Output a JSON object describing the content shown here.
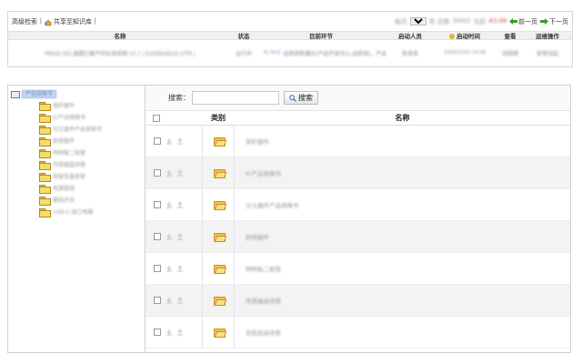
{
  "toolbar": {
    "advanced_search": "高级检索",
    "separator": "|",
    "share_label": "共享至知识库",
    "pager": {
      "page_text_1": "每页",
      "page_text_2": "条 总数",
      "total_count": "30402",
      "page_text_3": "当前",
      "current_page": "4/1-04",
      "prev_label": "前一页",
      "next_label": "下一页"
    }
  },
  "process_grid": {
    "columns": [
      "名称",
      "状态",
      "目前环节",
      "启动人员",
      "启动时间",
      "查看",
      "运维操作"
    ],
    "rows": [
      {
        "name": "PROD-002 晶圆已量产的标准规格 V1.7 ( D1D5624D15-1/TR )",
        "status": "运行中",
        "step": "IC N-D",
        "step_detail": "品质部陈康乐(产品开发中心-品质部)、产品",
        "starter": "陈某某",
        "start_time": "2023/11/01 15:36",
        "view": "流程图",
        "op": "审单挂起"
      }
    ]
  },
  "tree": {
    "root": "产品规格书",
    "items": [
      "保护器件",
      "IC产品规格书",
      "分立器件产品规格书",
      "射频器件",
      "特种板二极管",
      "传感器晶体管",
      "双极型晶体管",
      "电源管理",
      "模拟开关",
      "USB-C 接口电路"
    ]
  },
  "search": {
    "label": "搜索：",
    "input_value": "",
    "button_label": "搜索"
  },
  "list": {
    "col_type": "类别",
    "col_name": "名称",
    "rows": [
      {
        "name": "保护器件"
      },
      {
        "name": "IC产品规格书"
      },
      {
        "name": "分立器件产品规格书"
      },
      {
        "name": "射频器件"
      },
      {
        "name": "特种板二极管"
      },
      {
        "name": "传感器晶体管"
      },
      {
        "name": "双极型晶体管"
      }
    ]
  },
  "colors": {
    "tree_selected_bg": "#c8dcf4",
    "folder_yellow": "#f6dd6a",
    "header_bg": "#f0f0f0",
    "alt_row_bg": "#f3f3f3"
  },
  "icons": {
    "share": "share-hand-icon",
    "prev": "arrow-left-icon",
    "next": "arrow-right-icon",
    "search": "magnifier-icon",
    "tree_root": "monitor-icon",
    "folder": "folder-icon",
    "open_folder": "open-folder-icon",
    "row_actions": [
      "download-icon",
      "upload-icon"
    ]
  }
}
